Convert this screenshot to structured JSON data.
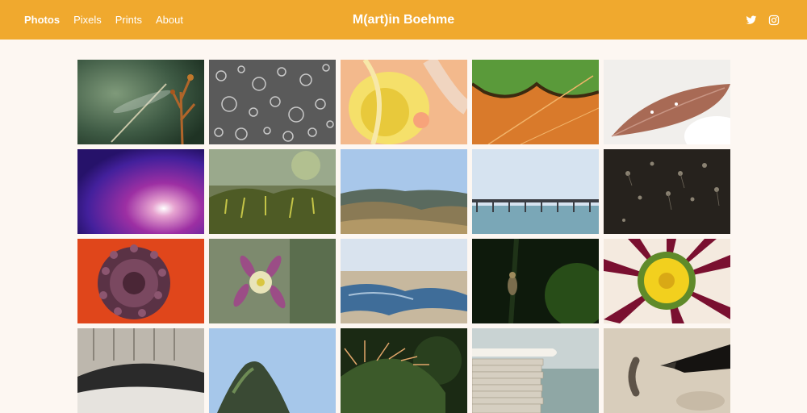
{
  "header": {
    "nav": [
      {
        "label": "Photos",
        "active": true
      },
      {
        "label": "Pixels",
        "active": false
      },
      {
        "label": "Prints",
        "active": false
      },
      {
        "label": "About",
        "active": false
      }
    ],
    "site_title": "M(art)in Boehme",
    "social": [
      {
        "icon": "twitter-icon"
      },
      {
        "icon": "instagram-icon"
      }
    ]
  },
  "colors": {
    "header_bg": "#f0a92e",
    "page_bg": "#fdf7f2",
    "header_text": "#ffffff"
  },
  "gallery": {
    "columns": 5,
    "photos": [
      {
        "subject": "dragonfly on plant"
      },
      {
        "subject": "bubbles black and white"
      },
      {
        "subject": "orange lily closeup"
      },
      {
        "subject": "green and orange leaf"
      },
      {
        "subject": "brown leaf in snow"
      },
      {
        "subject": "purple morning glory"
      },
      {
        "subject": "moss macro"
      },
      {
        "subject": "hills landscape"
      },
      {
        "subject": "pier over water"
      },
      {
        "subject": "seeds on dark background"
      },
      {
        "subject": "poppy center"
      },
      {
        "subject": "columbine flower"
      },
      {
        "subject": "beach with kelp"
      },
      {
        "subject": "insect on green stem"
      },
      {
        "subject": "gazania flower"
      },
      {
        "subject": "weathered wood"
      },
      {
        "subject": "sea stack rock"
      },
      {
        "subject": "cactus spines"
      },
      {
        "subject": "paper stack"
      },
      {
        "subject": "fountain pen ink stroke"
      }
    ]
  }
}
